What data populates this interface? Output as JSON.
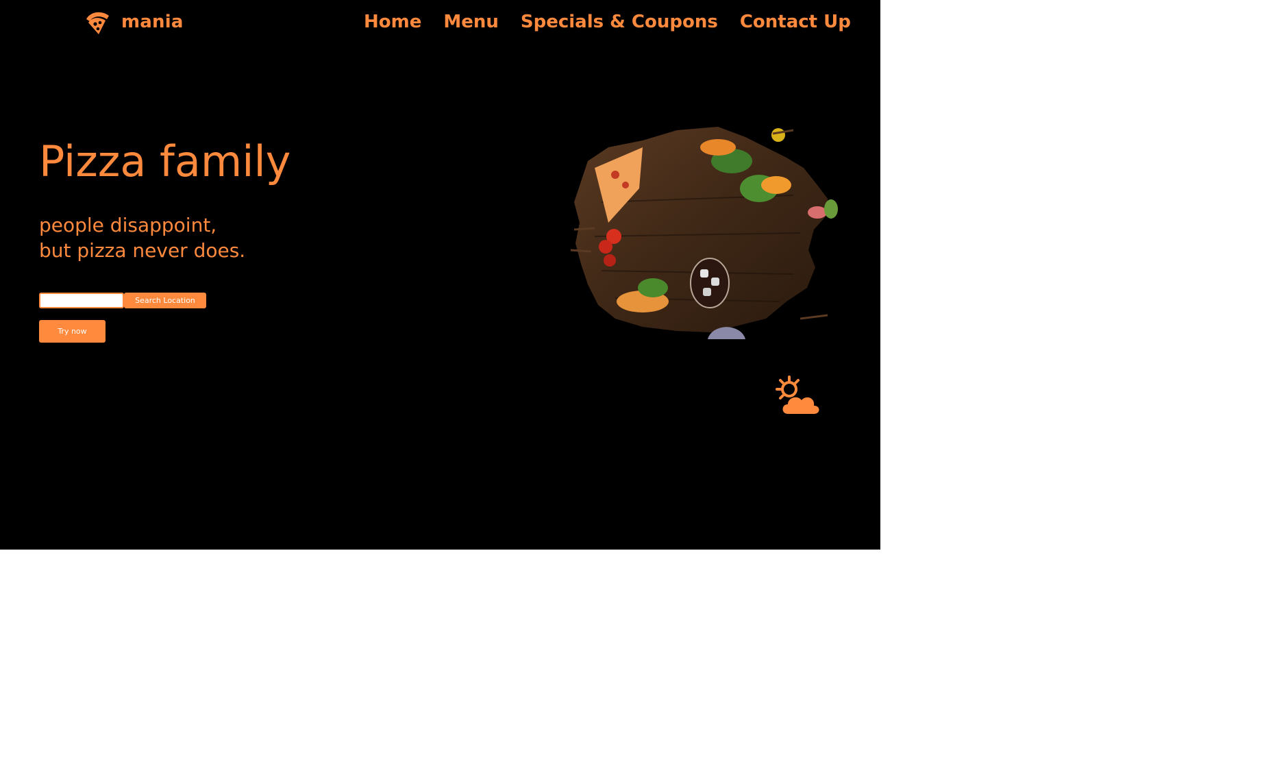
{
  "brand": {
    "name": "mania",
    "logo_icon": "pizza-slice-icon"
  },
  "nav": {
    "items": [
      {
        "label": "Home"
      },
      {
        "label": "Menu"
      },
      {
        "label": "Specials & Coupons"
      },
      {
        "label": "Contact Up"
      }
    ]
  },
  "hero": {
    "headline": "Pizza family",
    "tagline_line1": "people disappoint,",
    "tagline_line2": "but pizza never does.",
    "location_input_value": "",
    "search_button_label": "Search Location",
    "cta_label": "Try now",
    "image_content": "food-on-wooden-board",
    "weather_icon": "sun-cloud-icon"
  },
  "colors": {
    "accent": "#ff8a3d",
    "background": "#000000",
    "page": "#ffffff"
  }
}
